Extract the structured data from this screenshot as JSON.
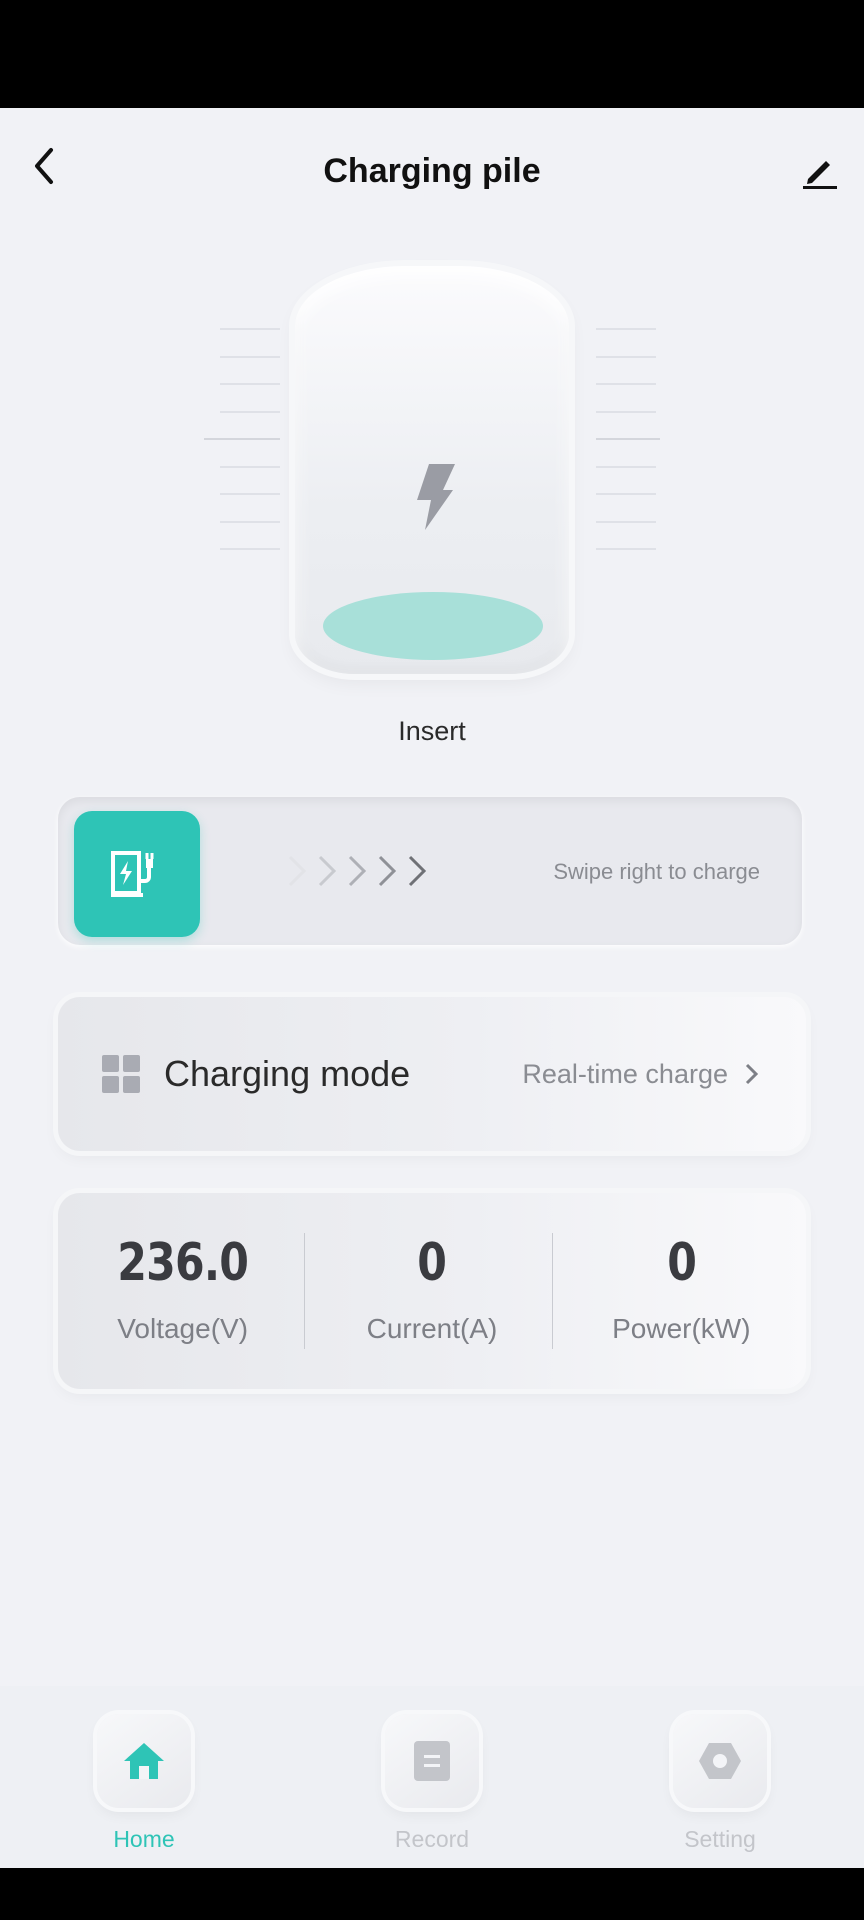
{
  "header": {
    "title": "Charging pile"
  },
  "charger": {
    "status": "Insert"
  },
  "swipe": {
    "hint": "Swipe right to charge"
  },
  "mode_card": {
    "label": "Charging mode",
    "value": "Real-time charge"
  },
  "metrics": [
    {
      "value": "236.0",
      "label": "Voltage(V)"
    },
    {
      "value": "0",
      "label": "Current(A)"
    },
    {
      "value": "0",
      "label": "Power(kW)"
    }
  ],
  "nav": {
    "items": [
      {
        "label": "Home",
        "icon": "home-icon",
        "active": true
      },
      {
        "label": "Record",
        "icon": "record-icon",
        "active": false
      },
      {
        "label": "Setting",
        "icon": "setting-icon",
        "active": false
      }
    ]
  },
  "colors": {
    "accent": "#2ec4b6",
    "background": "#f1f2f6"
  }
}
